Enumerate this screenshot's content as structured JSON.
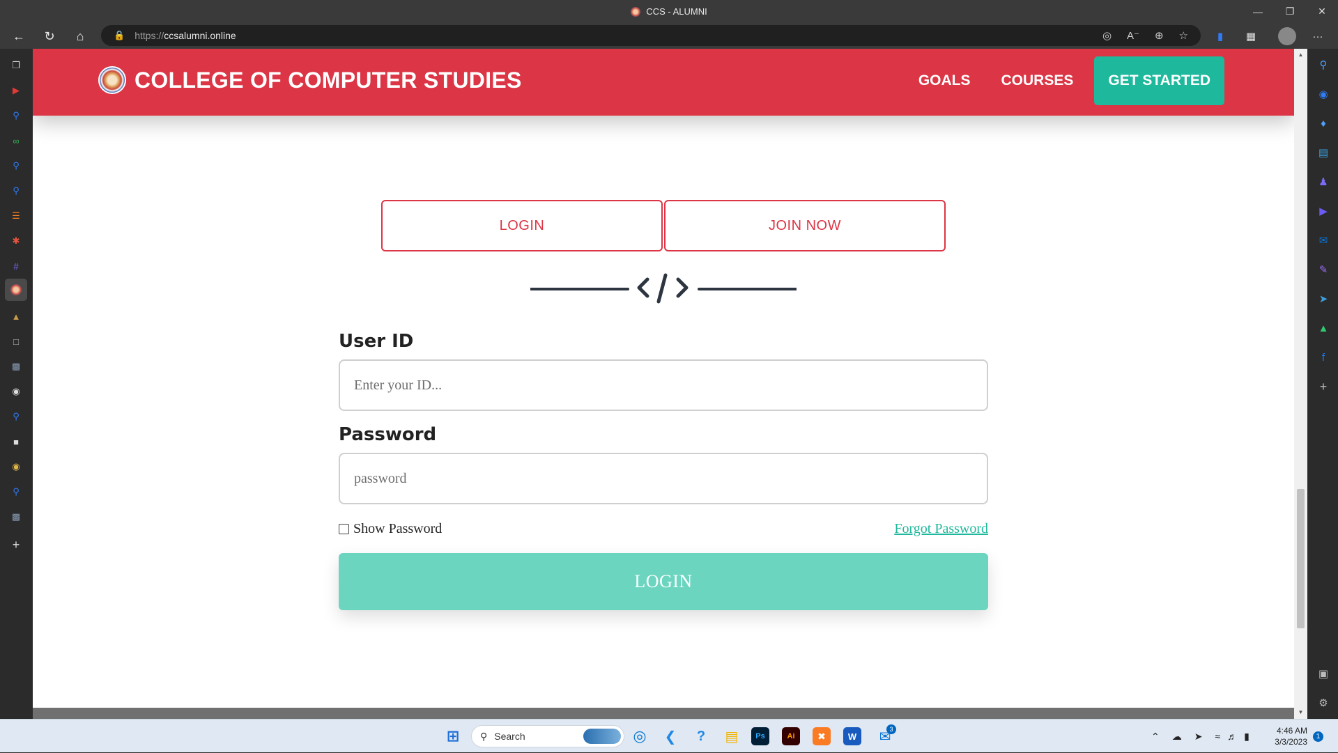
{
  "window": {
    "title": "CCS - ALUMNI",
    "minimize_icon": "minimize-icon",
    "restore_icon": "restore-icon",
    "close_icon": "close-icon"
  },
  "browser": {
    "url_protocol": "https://",
    "url_host": "ccsalumni.online",
    "more_glyph": "···"
  },
  "site": {
    "brand": "COLLEGE OF COMPUTER STUDIES",
    "nav": [
      "GOALS",
      "COURSES"
    ],
    "cta": "GET STARTED",
    "colors": {
      "primary": "#dc3545",
      "accent": "#1eb89c",
      "button": "#6bd5bf"
    }
  },
  "auth": {
    "tabs": [
      "LOGIN",
      "JOIN NOW"
    ],
    "divider_icon": "code-icon",
    "user_id_label": "User ID",
    "user_id_placeholder": "Enter your ID...",
    "password_label": "Password",
    "password_placeholder": "password",
    "show_password_label": "Show Password",
    "forgot_password": "Forgot Password",
    "submit_label": "LOGIN"
  },
  "taskbar": {
    "search_label": "Search",
    "time": "4:46 AM",
    "date": "3/3/2023",
    "notification_count": "1",
    "mail_badge": "3",
    "ps_label": "Ps",
    "ai_label": "Ai",
    "word_label": "W"
  }
}
